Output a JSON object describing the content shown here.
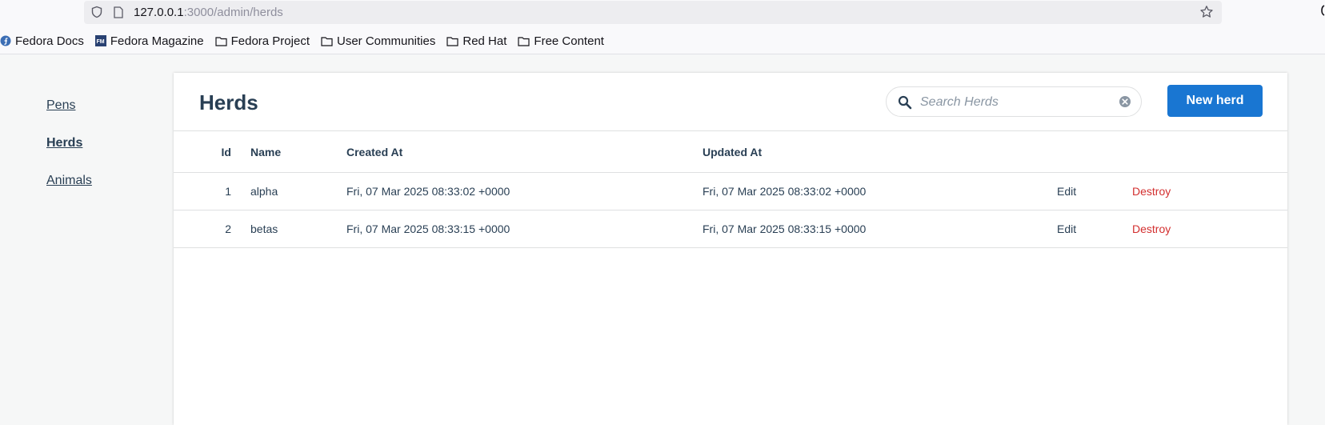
{
  "browser": {
    "url_host": "127.0.0.1",
    "url_rest": ":3000/admin/herds",
    "bookmarks": [
      {
        "label": "Fedora Docs",
        "icon": "fedora-icon"
      },
      {
        "label": "Fedora Magazine",
        "icon": "fm-icon"
      },
      {
        "label": "Fedora Project",
        "icon": "folder-icon"
      },
      {
        "label": "User Communities",
        "icon": "folder-icon"
      },
      {
        "label": "Red Hat",
        "icon": "folder-icon"
      },
      {
        "label": "Free Content",
        "icon": "folder-icon"
      }
    ]
  },
  "sidebar": {
    "items": [
      {
        "label": "Pens",
        "active": false
      },
      {
        "label": "Herds",
        "active": true
      },
      {
        "label": "Animals",
        "active": false
      }
    ]
  },
  "header": {
    "title": "Herds",
    "search_placeholder": "Search Herds",
    "new_button": "New herd"
  },
  "table": {
    "columns": [
      "Id",
      "Name",
      "Created At",
      "Updated At"
    ],
    "rows": [
      {
        "id": "1",
        "name": "alpha",
        "created_at": "Fri, 07 Mar 2025 08:33:02 +0000",
        "updated_at": "Fri, 07 Mar 2025 08:33:02 +0000",
        "edit": "Edit",
        "destroy": "Destroy"
      },
      {
        "id": "2",
        "name": "betas",
        "created_at": "Fri, 07 Mar 2025 08:33:15 +0000",
        "updated_at": "Fri, 07 Mar 2025 08:33:15 +0000",
        "edit": "Edit",
        "destroy": "Destroy"
      }
    ]
  },
  "colors": {
    "primary": "#1976d2",
    "destroy": "#d32f2f",
    "text": "#293f54",
    "background": "#f6f7f7"
  }
}
